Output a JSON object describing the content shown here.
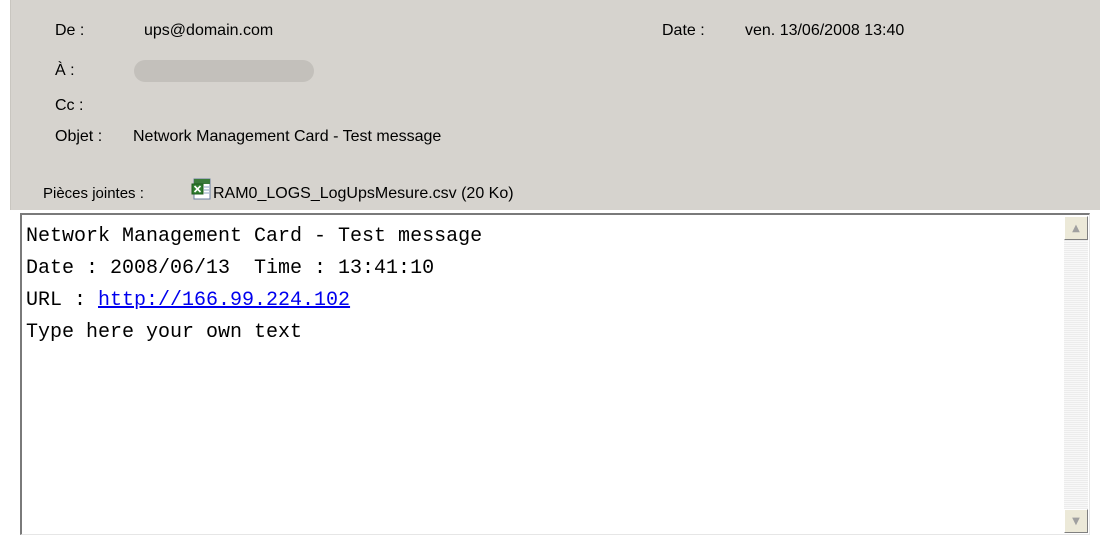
{
  "header": {
    "from_label": "De :",
    "from_value": "ups@domain.com",
    "date_label": "Date :",
    "date_value": "ven. 13/06/2008 13:40",
    "to_label": "À :",
    "cc_label": "Cc :",
    "subject_label": "Objet :",
    "subject_value": "Network Management Card - Test message",
    "attachments_label": "Pièces jointes :",
    "attachment_name": "RAM0_LOGS_LogUpsMesure.csv (20 Ko)",
    "attachment_icon": "excel-file-icon"
  },
  "body": {
    "line1": "Network Management Card - Test message",
    "line2": "Date : 2008/06/13  Time : 13:41:10",
    "line3_prefix": "URL : ",
    "url": "http://166.99.224.102",
    "line4": "Type here your own text"
  },
  "scrollbar": {
    "up_icon": "scroll-up-arrow-icon",
    "down_icon": "scroll-down-arrow-icon"
  },
  "colors": {
    "header_bg": "#d6d3ce",
    "link": "#0000ee",
    "redaction": "#c3c0bb"
  }
}
